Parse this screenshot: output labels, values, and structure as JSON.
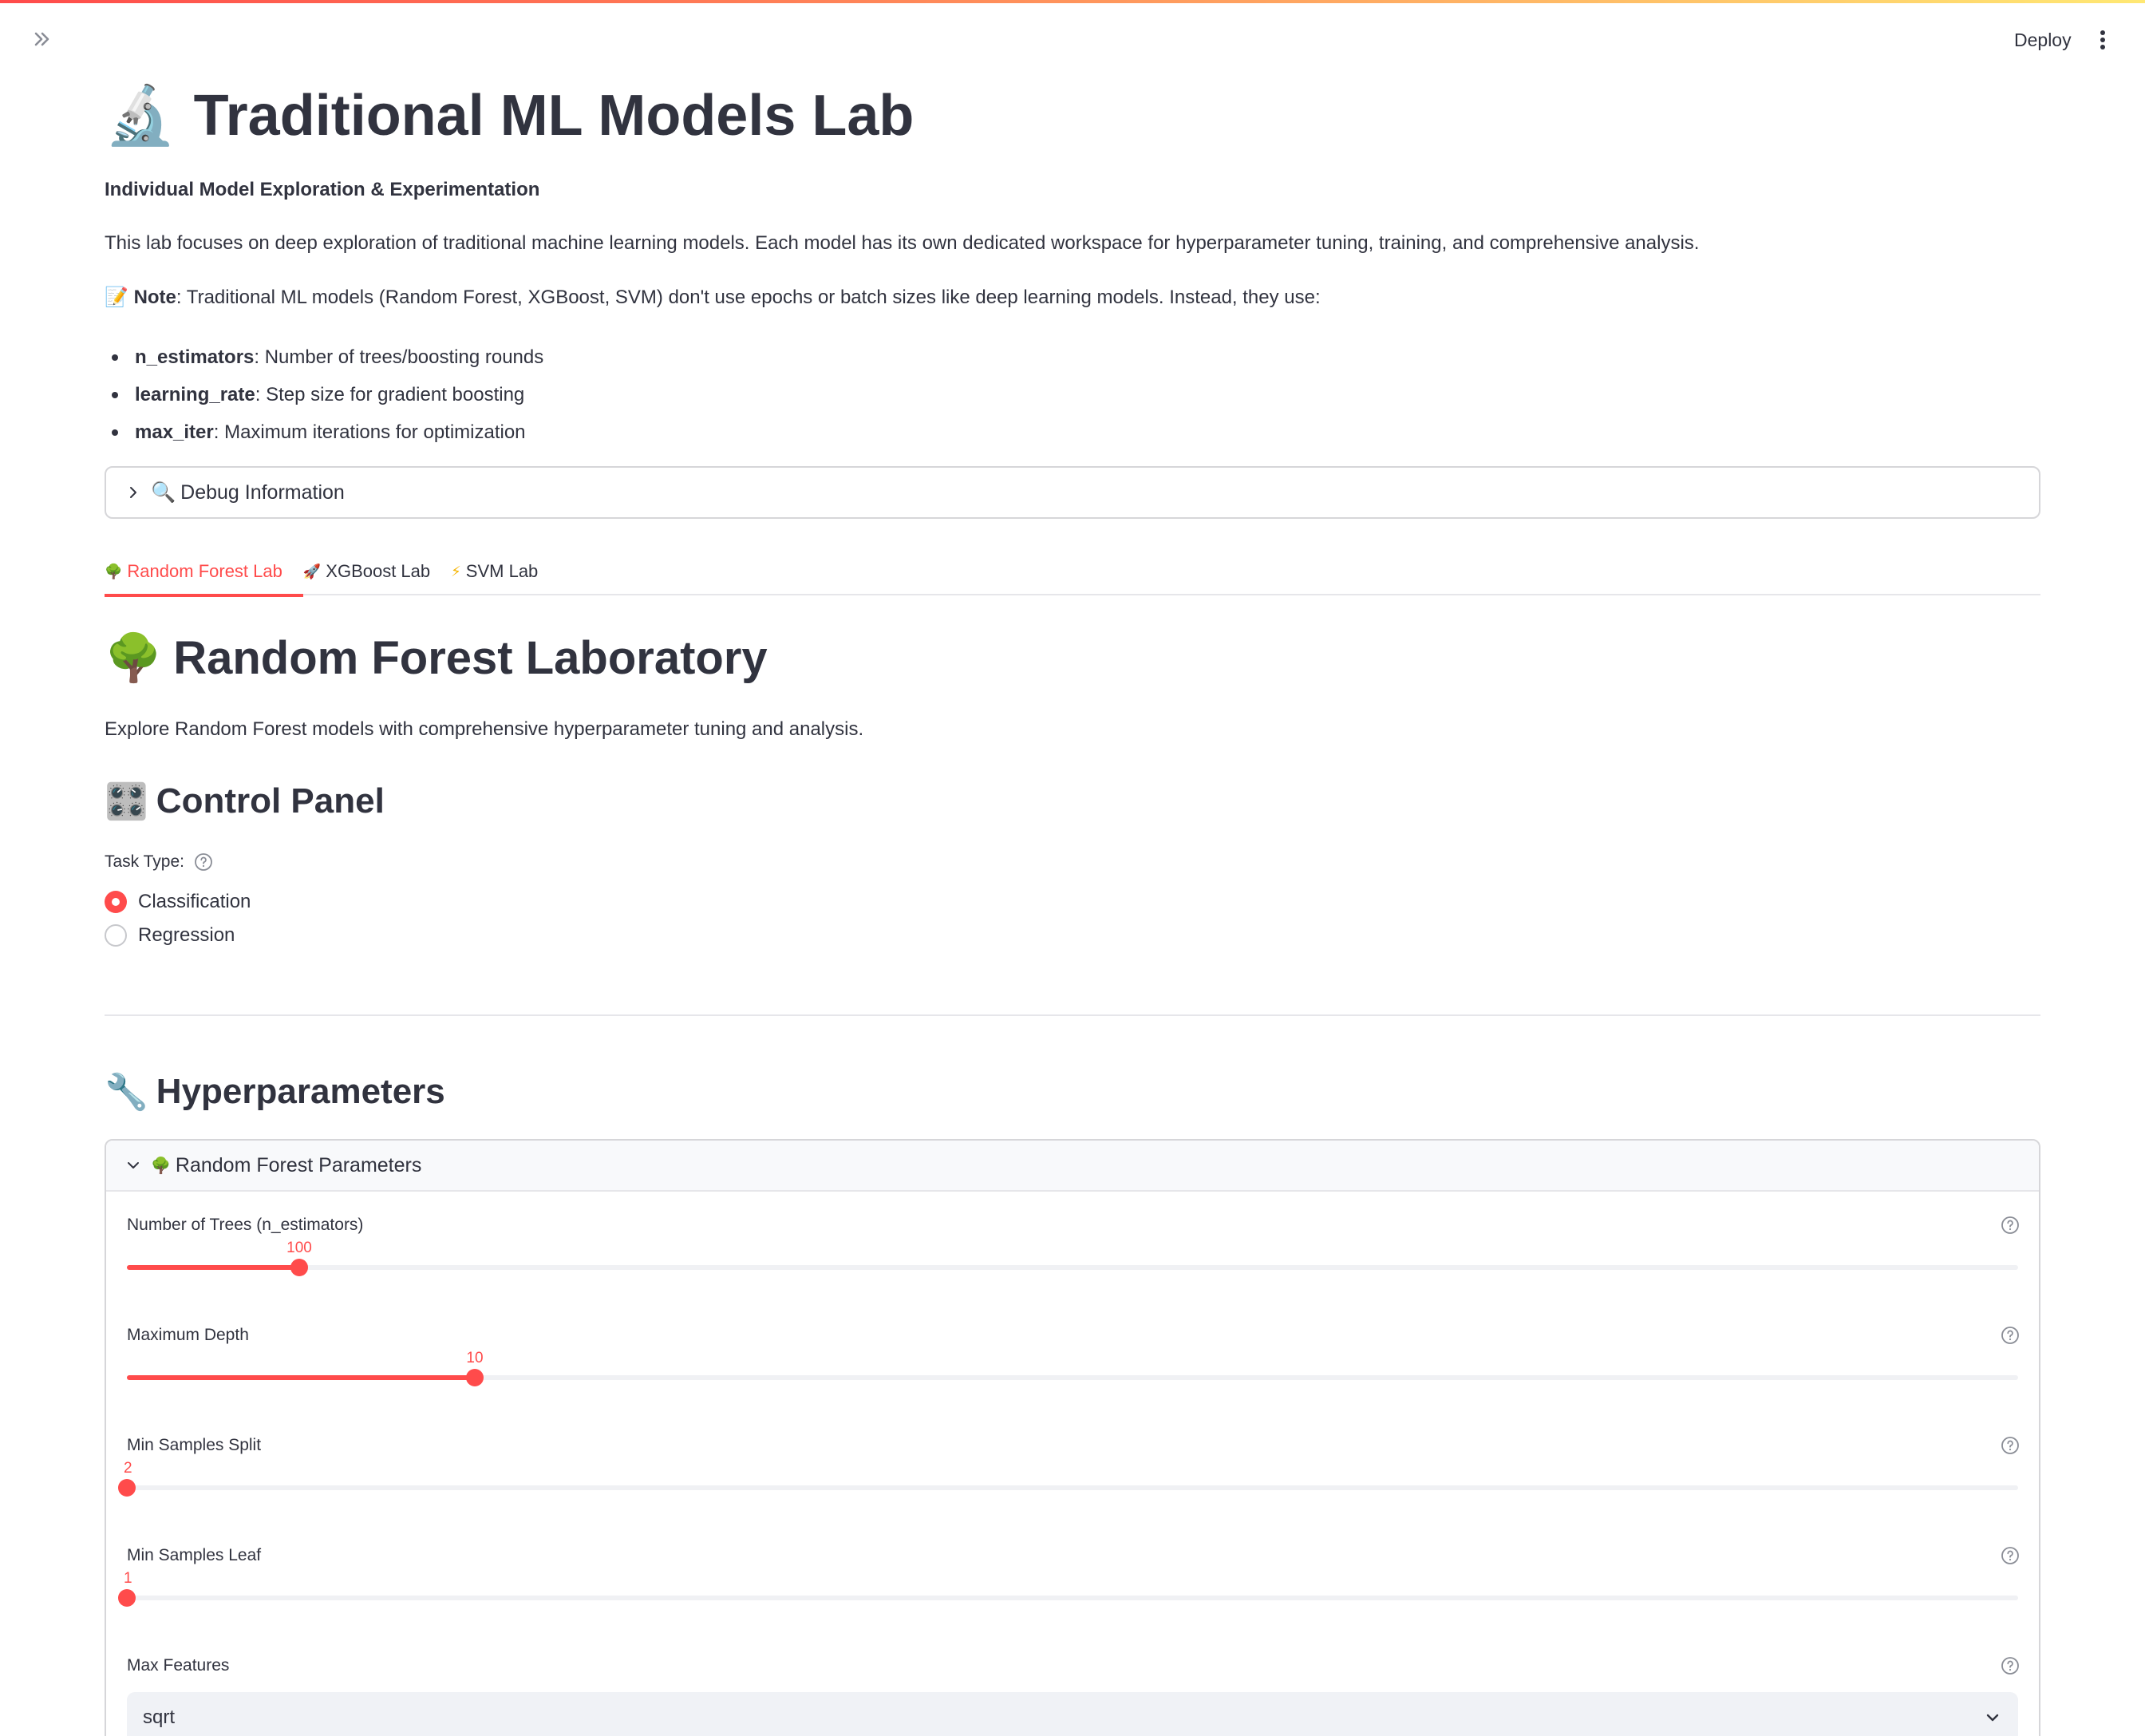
{
  "header": {
    "deploy_label": "Deploy"
  },
  "page": {
    "title_icon": "🔬",
    "title": "Traditional ML Models Lab",
    "subtitle": "Individual Model Exploration & Experimentation",
    "intro": "This lab focuses on deep exploration of traditional machine learning models. Each model has its own dedicated workspace for hyperparameter tuning, training, and comprehensive analysis.",
    "note_icon": "📝",
    "note_label": "Note",
    "note_text": ": Traditional ML models (Random Forest, XGBoost, SVM) don't use epochs or batch sizes like deep learning models. Instead, they use:",
    "bullets": [
      {
        "term": "n_estimators",
        "desc": ": Number of trees/boosting rounds"
      },
      {
        "term": "learning_rate",
        "desc": ": Step size for gradient boosting"
      },
      {
        "term": "max_iter",
        "desc": ": Maximum iterations for optimization"
      }
    ]
  },
  "debug_expander": {
    "icon": "🔍",
    "label": "Debug Information"
  },
  "tabs": [
    {
      "icon": "🌳",
      "label": "Random Forest Lab",
      "active": true
    },
    {
      "icon": "🚀",
      "label": "XGBoost Lab",
      "active": false
    },
    {
      "icon": "⚡",
      "label": "SVM Lab",
      "active": false
    }
  ],
  "rf": {
    "heading_icon": "🌳",
    "heading": "Random Forest Laboratory",
    "description": "Explore Random Forest models with comprehensive hyperparameter tuning and analysis.",
    "control_icon": "🎛️",
    "control_heading": "Control Panel",
    "task_type_label": "Task Type:",
    "task_options": [
      {
        "label": "Classification",
        "selected": true
      },
      {
        "label": "Regression",
        "selected": false
      }
    ],
    "hyper_icon": "🔧",
    "hyper_heading": "Hyperparameters",
    "params_expander_icon": "🌳",
    "params_expander_label": "Random Forest Parameters",
    "sliders": [
      {
        "label": "Number of Trees (n_estimators)",
        "value": "100",
        "fraction": 0.091
      },
      {
        "label": "Maximum Depth",
        "value": "10",
        "fraction": 0.184
      },
      {
        "label": "Min Samples Split",
        "value": "2",
        "fraction": 0.0
      },
      {
        "label": "Min Samples Leaf",
        "value": "1",
        "fraction": 0.0
      }
    ],
    "max_features_label": "Max Features",
    "max_features_value": "sqrt"
  },
  "colors": {
    "accent": "#ff4b4b",
    "text": "#31333f",
    "border": "#d6d6d9"
  }
}
